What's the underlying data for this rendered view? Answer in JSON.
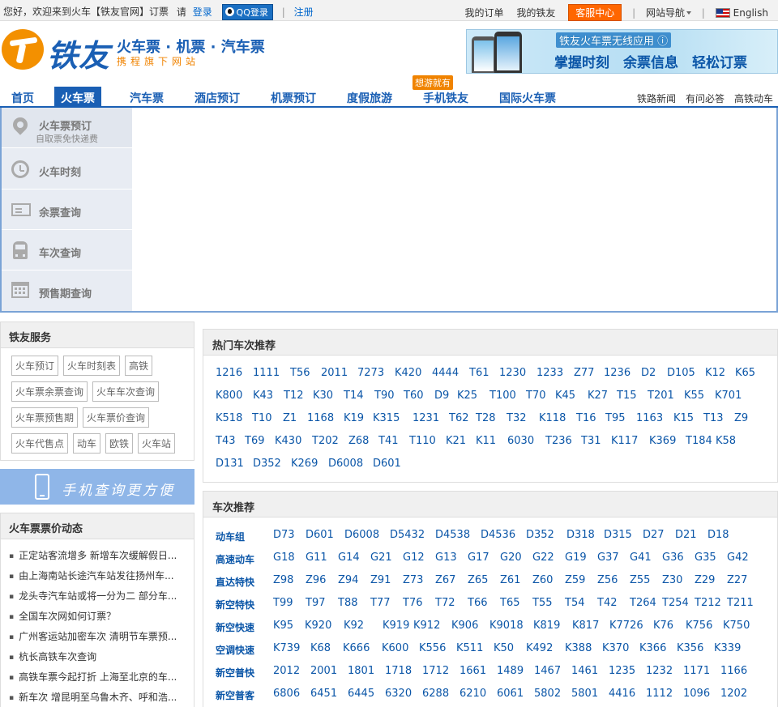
{
  "topbar": {
    "welcome": "您好，欢迎来到火车【铁友官网】订票",
    "please": "请",
    "login": "登录",
    "qq_login": "QQ登录",
    "register": "注册",
    "my_orders": "我的订单",
    "my_tieyou": "我的铁友",
    "service": "客服中心",
    "site_nav": "网站导航",
    "english": "English"
  },
  "header": {
    "logo_name": "铁友",
    "tagline": "火车票 · 机票 · 汽车票",
    "subline": "携程旗下网站",
    "banner_title": "铁友火车票无线应用 ⓘ",
    "banner_slogan": "掌握时刻　余票信息　轻松订票"
  },
  "nav": {
    "items": [
      "首页",
      "火车票",
      "汽车票",
      "酒店预订",
      "机票预订",
      "度假旅游",
      "手机铁友",
      "国际火车票"
    ],
    "promo": "想游就有",
    "right_links": [
      "铁路新闻",
      "有问必答",
      "高铁动车"
    ]
  },
  "booking_options": [
    {
      "label": "火车票预订",
      "sub": "自取票免快递费"
    },
    {
      "label": "火车时刻",
      "sub": ""
    },
    {
      "label": "余票查询",
      "sub": ""
    },
    {
      "label": "车次查询",
      "sub": ""
    },
    {
      "label": "预售期查询",
      "sub": ""
    }
  ],
  "services": {
    "title": "铁友服务",
    "tags": [
      "火车预订",
      "火车时刻表",
      "高铁",
      "火车票余票查询",
      "火车车次查询",
      "火车票预售期",
      "火车票价查询",
      "火车代售点",
      "动车",
      "欧铁",
      "火车站"
    ]
  },
  "mobile_banner": "手机查询更方便",
  "price_news": {
    "title": "火车票票价动态",
    "items": [
      "正定站客流增多 新增车次缓解假日...",
      "由上海南站长途汽车站发往扬州车...",
      "龙头寺汽车站或将一分为二 部分车...",
      "全国车次网如何订票？",
      "广州客运站加密车次 清明节车票预...",
      "杭长高铁车次查询",
      "高铁车票今起打折 上海至北京的车...",
      "新车次 增昆明至乌鲁木齐、呼和浩..."
    ]
  },
  "hot_trains": {
    "title": "热门车次推荐",
    "rows": [
      [
        "1216",
        "1111",
        "T56",
        "2011",
        "7273",
        "K420",
        "4444",
        "T61",
        "1230",
        "1233",
        "Z77",
        "1236",
        "D2",
        "D105",
        "K12",
        "K65"
      ],
      [
        "K800",
        "K43",
        "T12",
        "K30",
        "T14",
        "T90",
        "T60",
        "D9",
        "K25",
        "T100",
        "T70",
        "K45",
        "K27",
        "T15",
        "T201",
        "K55",
        "K701"
      ],
      [
        "K518",
        "T10",
        "Z1",
        "1168",
        "K19",
        "K315",
        "1231",
        "T62",
        "T28",
        "T32",
        "K118",
        "T16",
        "T95",
        "1163",
        "K15",
        "T13",
        "Z9"
      ],
      [
        "T43",
        "T69",
        "K430",
        "T202",
        "Z68",
        "T41",
        "T110",
        "K21",
        "K11",
        "6030",
        "T236",
        "T31",
        "K117",
        "K369",
        "T184",
        "K58"
      ],
      [
        "D131",
        "D352",
        "K269",
        "D6008",
        "D601"
      ]
    ]
  },
  "recommend": {
    "title": "车次推荐",
    "rows": [
      {
        "cat": "动车组",
        "codes": [
          "D73",
          "D601",
          "D6008",
          "D5432",
          "D4538",
          "D4536",
          "D352",
          "D318",
          "D315",
          "D27",
          "D21",
          "D18"
        ]
      },
      {
        "cat": "高速动车",
        "codes": [
          "G18",
          "G11",
          "G14",
          "G21",
          "G12",
          "G13",
          "G17",
          "G20",
          "G22",
          "G19",
          "G37",
          "G41",
          "G36",
          "G35",
          "G42"
        ]
      },
      {
        "cat": "直达特快",
        "codes": [
          "Z98",
          "Z96",
          "Z94",
          "Z91",
          "Z73",
          "Z67",
          "Z65",
          "Z61",
          "Z60",
          "Z59",
          "Z56",
          "Z55",
          "Z30",
          "Z29",
          "Z27"
        ]
      },
      {
        "cat": "新空特快",
        "codes": [
          "T99",
          "T97",
          "T88",
          "T77",
          "T76",
          "T72",
          "T66",
          "T65",
          "T55",
          "T54",
          "T42",
          "T264",
          "T254",
          "T212",
          "T211"
        ]
      },
      {
        "cat": "新空快速",
        "codes": [
          "K95",
          "K920",
          "K92",
          "K919",
          "K912",
          "K906",
          "K9018",
          "K819",
          "K817",
          "K7726",
          "K76",
          "K756",
          "K750"
        ]
      },
      {
        "cat": "空调快速",
        "codes": [
          "K739",
          "K68",
          "K666",
          "K600",
          "K556",
          "K511",
          "K50",
          "K492",
          "K388",
          "K370",
          "K366",
          "K356",
          "K339"
        ]
      },
      {
        "cat": "新空普快",
        "codes": [
          "2012",
          "2001",
          "1801",
          "1718",
          "1712",
          "1661",
          "1489",
          "1467",
          "1461",
          "1235",
          "1232",
          "1171",
          "1166"
        ]
      },
      {
        "cat": "新空普客",
        "codes": [
          "6806",
          "6451",
          "6445",
          "6320",
          "6288",
          "6210",
          "6061",
          "5802",
          "5801",
          "4416",
          "1112",
          "1096",
          "1202"
        ]
      }
    ]
  }
}
